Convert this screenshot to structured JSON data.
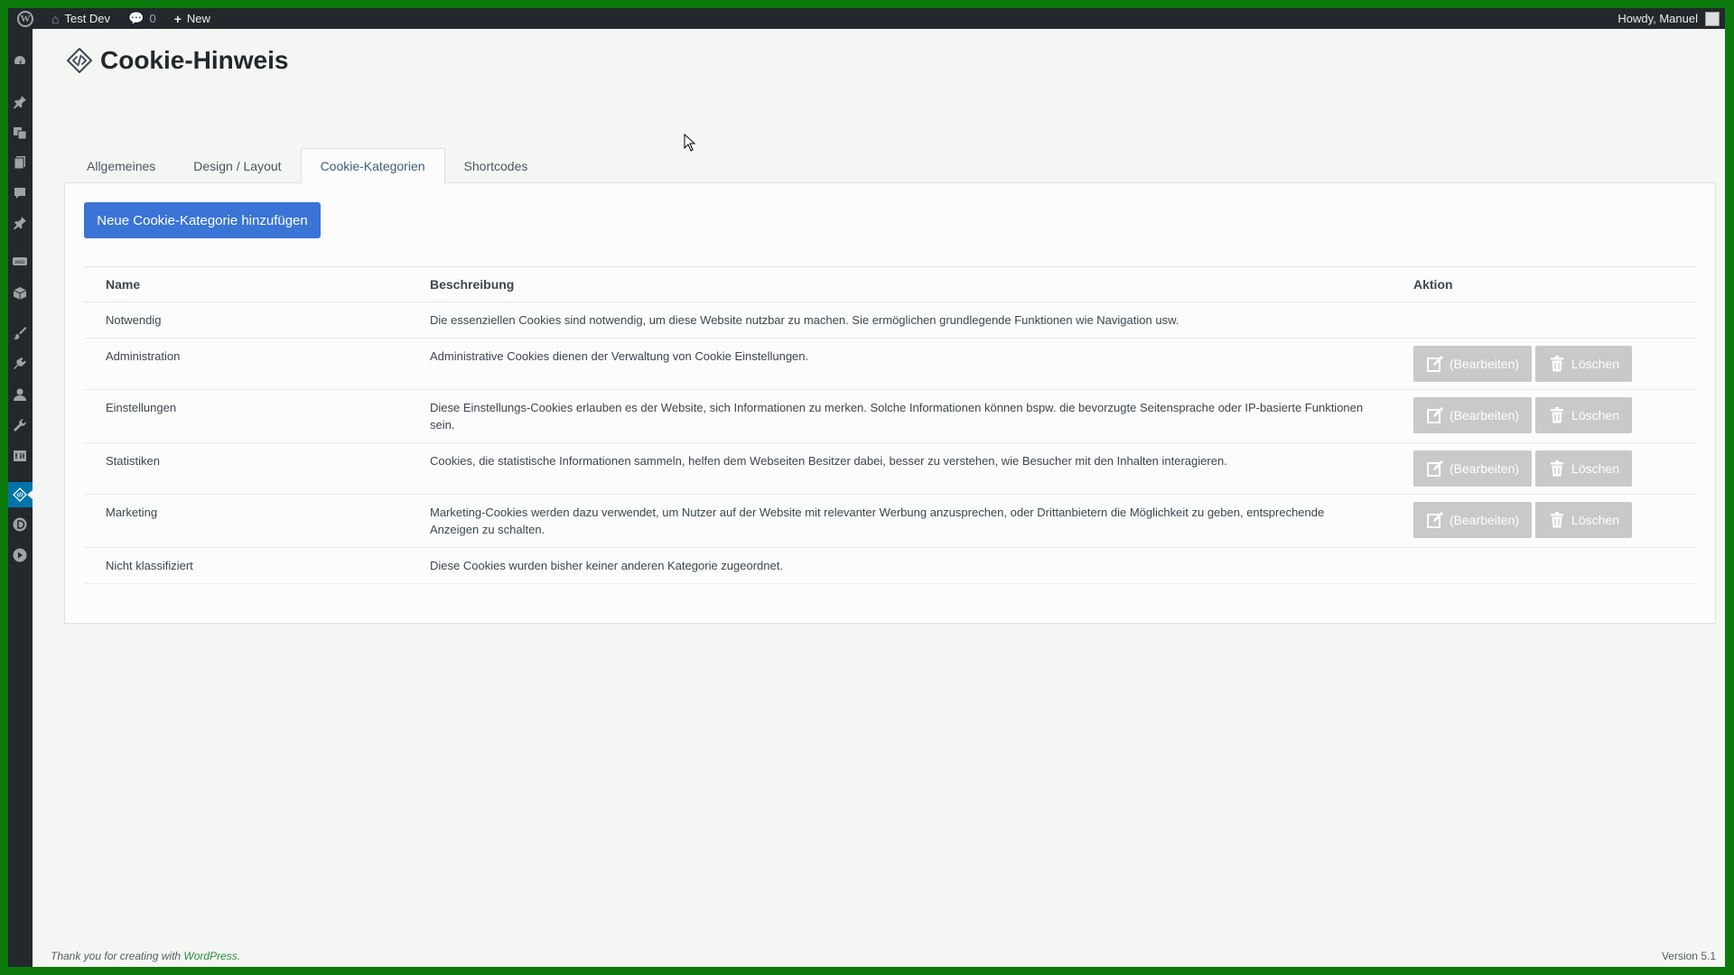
{
  "adminbar": {
    "site_name": "Test Dev",
    "comments_count": "0",
    "new_label": "New",
    "greeting": "Howdy, Manuel"
  },
  "sidebar": {
    "icons": [
      "dashboard-icon",
      "pin-icon",
      "media-icon",
      "pages-icon",
      "comments-icon",
      "pin-icon",
      "woo-icon",
      "box-icon",
      "appearance-icon",
      "plugins-icon",
      "users-icon",
      "tools-icon",
      "settings-icon",
      "cookie-notice-icon",
      "d-icon",
      "play-icon"
    ],
    "active": "cookie-notice-icon"
  },
  "page": {
    "title": "Cookie-Hinweis"
  },
  "tabs": [
    {
      "label": "Allgemeines",
      "active": false
    },
    {
      "label": "Design / Layout",
      "active": false
    },
    {
      "label": "Cookie-Kategorien",
      "active": true
    },
    {
      "label": "Shortcodes",
      "active": false
    }
  ],
  "panel": {
    "add_button": "Neue Cookie-Kategorie hinzufügen",
    "columns": {
      "name": "Name",
      "description": "Beschreibung",
      "action": "Aktion"
    },
    "edit_label": "(Bearbeiten)",
    "delete_label": "Löschen",
    "rows": [
      {
        "name": "Notwendig",
        "description": "Die essenziellen Cookies sind notwendig, um diese Website nutzbar zu machen. Sie ermöglichen grundlegende Funktionen wie Navigation usw.",
        "actions": false
      },
      {
        "name": "Administration",
        "description": "Administrative Cookies dienen der Verwaltung von Cookie Einstellungen.",
        "actions": true
      },
      {
        "name": "Einstellungen",
        "description": "Diese Einstellungs-Cookies erlauben es der Website, sich Informationen zu merken. Solche Informationen können bspw. die bevorzugte Seitensprache oder IP-basierte Funktionen sein.",
        "actions": true
      },
      {
        "name": "Statistiken",
        "description": "Cookies, die statistische Informationen sammeln, helfen dem Webseiten Besitzer dabei, besser zu verstehen, wie Besucher mit den Inhalten interagieren.",
        "actions": true
      },
      {
        "name": "Marketing",
        "description": "Marketing-Cookies werden dazu verwendet, um Nutzer auf der Website mit relevanter Werbung anzusprechen, oder Drittanbietern die Möglichkeit zu geben, entsprechende Anzeigen zu schalten.",
        "actions": true
      },
      {
        "name": "Nicht klassifiziert",
        "description": "Diese Cookies wurden bisher keiner anderen Kategorie zugeordnet.",
        "actions": false
      }
    ]
  },
  "footer": {
    "thanks_prefix": "Thank you for creating with ",
    "thanks_link": "WordPress",
    "thanks_suffix": ".",
    "version": "Version 5.1"
  },
  "colors": {
    "frame_border": "#0d7a0d",
    "admin_bar": "#23282d",
    "primary_button": "#3a74d6",
    "action_button": "#c7c9cb",
    "menu_active": "#0073aa"
  }
}
